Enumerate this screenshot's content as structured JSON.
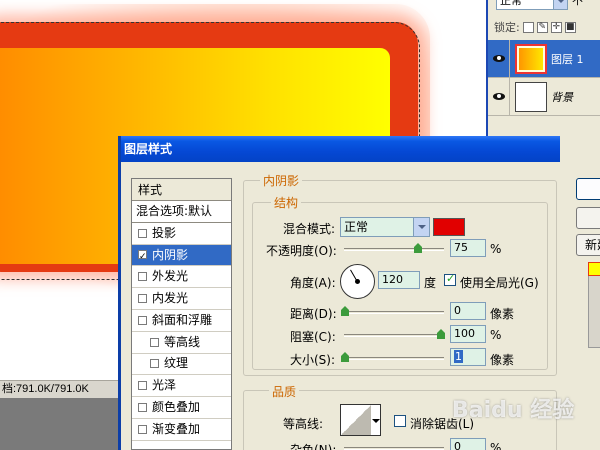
{
  "status_bar": {
    "doc_size": "档:791.0K/791.0K"
  },
  "layers_panel": {
    "blend_mode": "正常",
    "opacity_stub": "不",
    "lock_label": "锁定:",
    "layers": [
      {
        "name": "图层 1",
        "selected": true
      },
      {
        "name": "背景",
        "selected": false
      }
    ]
  },
  "dialog": {
    "title": "图层样式",
    "style_list": {
      "header": "样式",
      "blend_options": "混合选项:默认",
      "items": [
        {
          "label": "投影",
          "checked": false,
          "sub": false
        },
        {
          "label": "内阴影",
          "checked": true,
          "sub": false,
          "selected": true
        },
        {
          "label": "外发光",
          "checked": false,
          "sub": false
        },
        {
          "label": "内发光",
          "checked": false,
          "sub": false
        },
        {
          "label": "斜面和浮雕",
          "checked": false,
          "sub": false
        },
        {
          "label": "等高线",
          "checked": false,
          "sub": true
        },
        {
          "label": "纹理",
          "checked": false,
          "sub": true
        },
        {
          "label": "光泽",
          "checked": false,
          "sub": false
        },
        {
          "label": "颜色叠加",
          "checked": false,
          "sub": false
        },
        {
          "label": "渐变叠加",
          "checked": false,
          "sub": false
        }
      ]
    },
    "inner_shadow": {
      "section_title": "内阴影",
      "structure_title": "结构",
      "blend_mode_label": "混合模式:",
      "blend_mode_value": "正常",
      "shadow_color": "#e10000",
      "opacity_label": "不透明度(O):",
      "opacity_value": "75",
      "opacity_unit": "%",
      "angle_label": "角度(A):",
      "angle_value": "120",
      "angle_unit": "度",
      "global_light_label": "使用全局光(G)",
      "global_light_checked": true,
      "distance_label": "距离(D):",
      "distance_value": "0",
      "distance_unit": "像素",
      "choke_label": "阻塞(C):",
      "choke_value": "100",
      "choke_unit": "%",
      "size_label": "大小(S):",
      "size_value": "1",
      "size_unit": "像素"
    },
    "quality": {
      "section_title": "品质",
      "contour_label": "等高线:",
      "antialias_label": "消除锯齿(L)",
      "noise_label": "杂色(N):",
      "noise_value": "0",
      "noise_unit": "%"
    },
    "buttons": {
      "new_style": "新建"
    }
  },
  "watermark": "Baidu 经验"
}
